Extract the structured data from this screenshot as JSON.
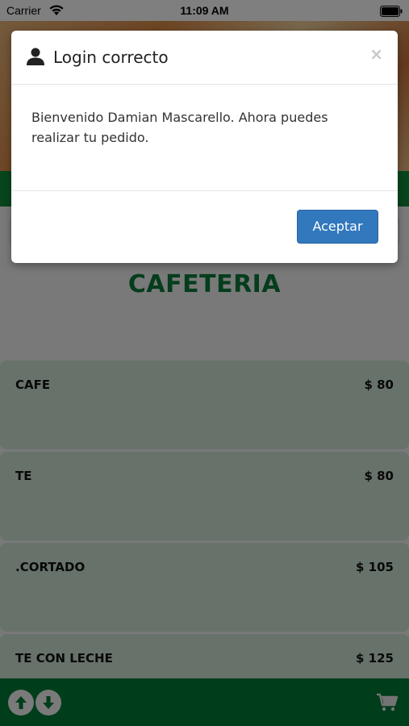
{
  "status_bar": {
    "carrier": "Carrier",
    "time": "11:09 AM"
  },
  "main": {
    "section_title": "CAFETERIA",
    "products": [
      {
        "name": "CAFE",
        "price": "$ 80"
      },
      {
        "name": "TE",
        "price": "$ 80"
      },
      {
        "name": ".CORTADO",
        "price": "$ 105"
      },
      {
        "name": "TE CON LECHE",
        "price": "$ 125"
      }
    ]
  },
  "modal": {
    "title": "Login correcto",
    "close_glyph": "×",
    "message": "Bienvenido Damian Mascarello. Ahora puedes realizar tu pedido.",
    "accept_label": "Aceptar"
  },
  "icons": {
    "header": "user-icon",
    "close": "close-icon",
    "scroll_up": "arrow-up-icon",
    "scroll_down": "arrow-down-icon",
    "cart": "cart-icon"
  },
  "colors": {
    "brand_green": "#0b7a3a",
    "bottom_bar": "#007a34",
    "accept_button": "#3278bd",
    "product_card": "#cfe4d6"
  }
}
